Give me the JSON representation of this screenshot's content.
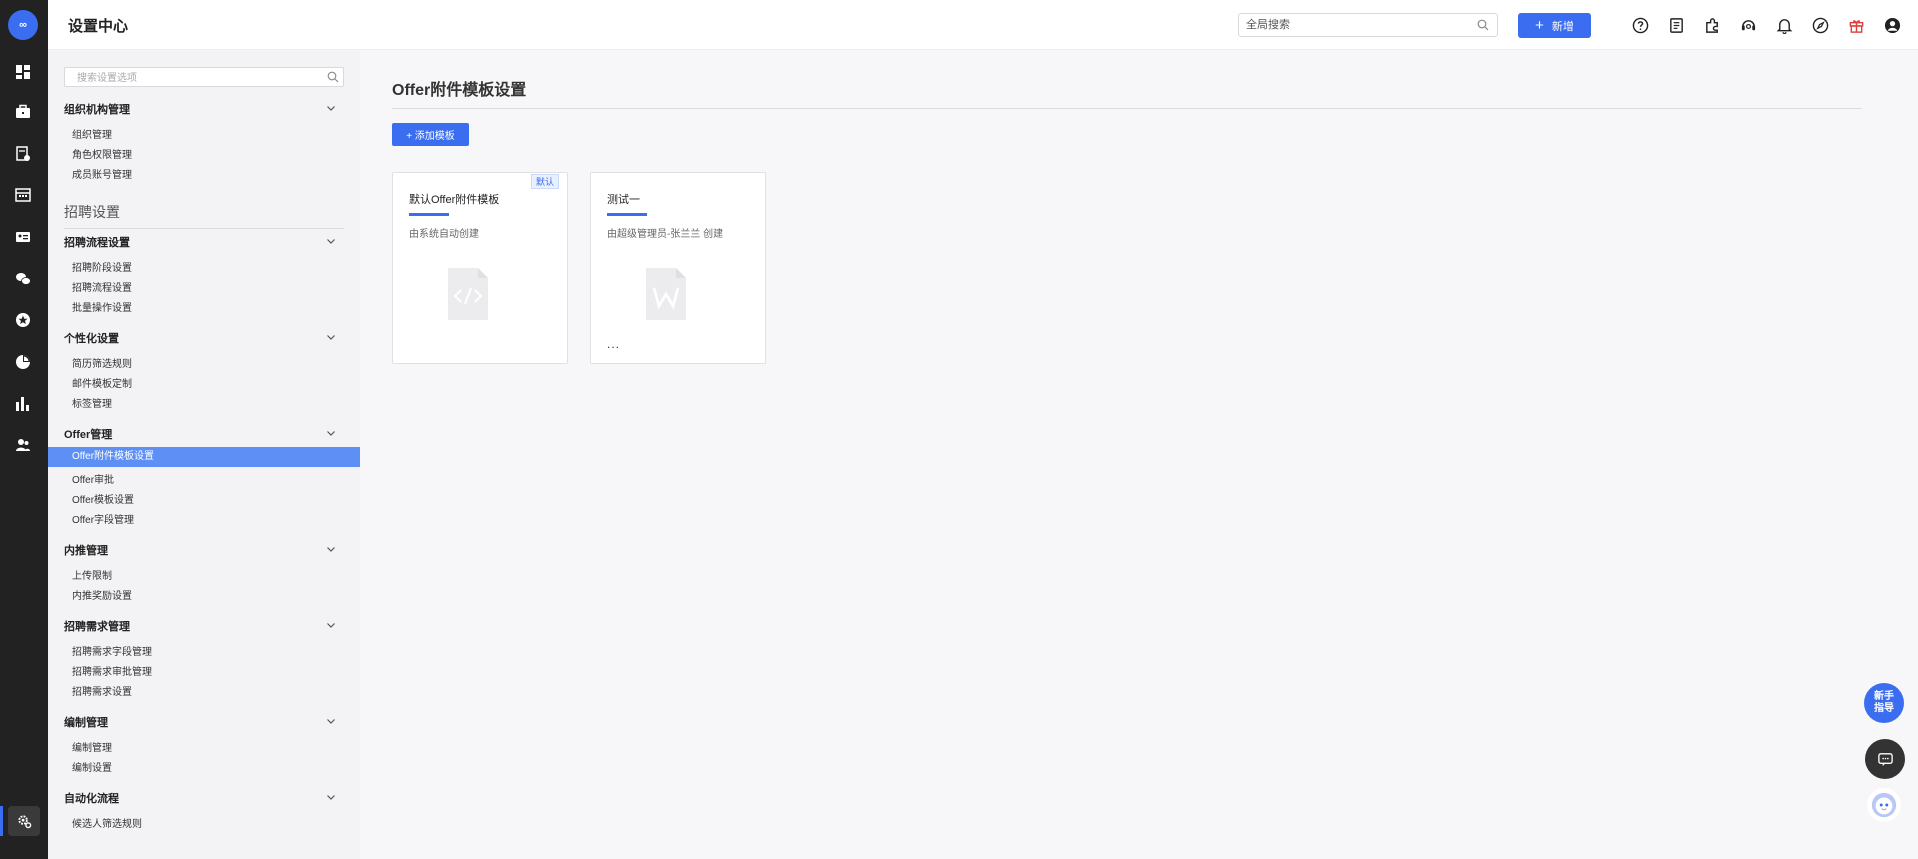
{
  "app": {
    "title": "设置中心",
    "logo_text": "∞"
  },
  "topbar": {
    "search_placeholder": "全局搜索",
    "new_label": "新增",
    "new_plus": "+",
    "icons": [
      "help-icon",
      "document-icon",
      "puzzle-icon",
      "support-icon",
      "bell-icon",
      "compass-icon",
      "gift-icon",
      "user-icon"
    ]
  },
  "rail": {
    "icons": [
      "dashboard-icon",
      "briefcase-icon",
      "resume-icon",
      "calendar-icon",
      "id-card-icon",
      "wechat-icon",
      "star-icon",
      "pie-chart-icon",
      "bar-chart-icon",
      "people-icon"
    ],
    "settings_icon": "settings-gear-icon"
  },
  "sidebar": {
    "search_placeholder": "搜索设置选项",
    "section_title": "招聘设置",
    "groups": [
      {
        "title": "组织机构管理",
        "items": [
          "组织管理",
          "角色权限管理",
          "成员账号管理"
        ]
      },
      {
        "title": "招聘流程设置",
        "items": [
          "招聘阶段设置",
          "招聘流程设置",
          "批量操作设置"
        ]
      },
      {
        "title": "个性化设置",
        "items": [
          "简历筛选规则",
          "邮件模板定制",
          "标签管理"
        ]
      },
      {
        "title": "Offer管理",
        "items": [
          "Offer附件模板设置",
          "Offer审批",
          "Offer模板设置",
          "Offer字段管理"
        ]
      },
      {
        "title": "内推管理",
        "items": [
          "上传限制",
          "内推奖励设置"
        ]
      },
      {
        "title": "招聘需求管理",
        "items": [
          "招聘需求字段管理",
          "招聘需求审批管理",
          "招聘需求设置"
        ]
      },
      {
        "title": "编制管理",
        "items": [
          "编制管理",
          "编制设置"
        ]
      },
      {
        "title": "自动化流程",
        "items": [
          "候选人筛选规则"
        ]
      }
    ]
  },
  "main": {
    "title": "Offer附件模板设置",
    "add_label": "+ 添加模板",
    "cards": [
      {
        "name": "默认Offer附件模板",
        "by": "由系统自动创建",
        "badge": "默认",
        "doc_icon": "code-file-icon"
      },
      {
        "name": "测试一",
        "by": "由超级管理员-张兰兰 创建",
        "more": "...",
        "doc_icon": "word-file-icon"
      }
    ]
  },
  "floating": {
    "guide_line1": "新手",
    "guide_line2": "指导"
  },
  "colors": {
    "accent": "#3a6df0",
    "active_item": "#5d8ff5",
    "rail_bg": "#222222"
  }
}
